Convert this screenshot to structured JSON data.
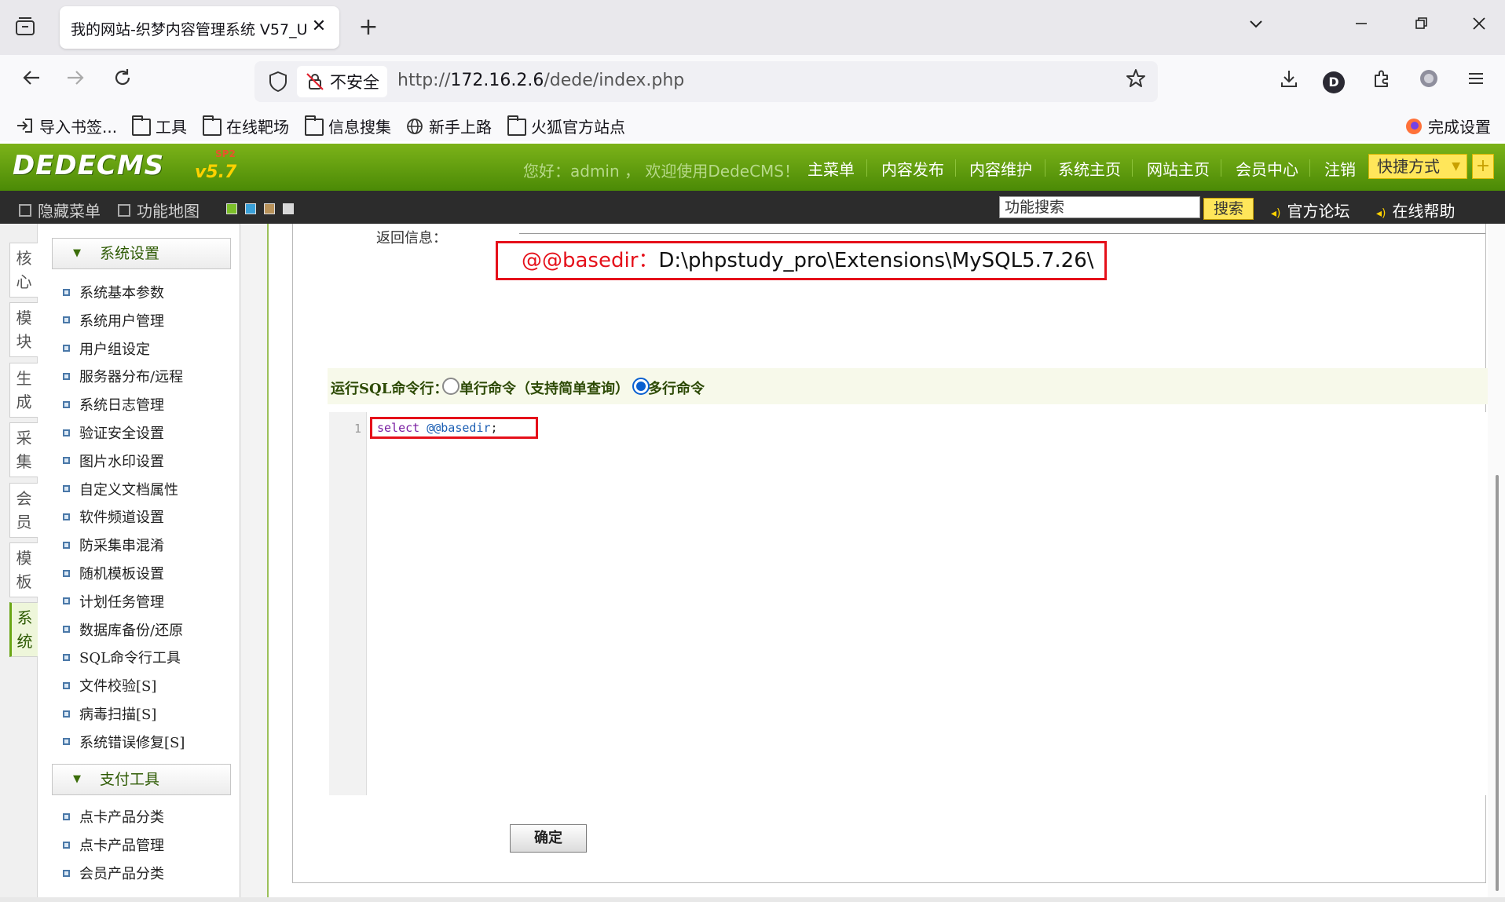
{
  "browser": {
    "tab_title": "我的网站-织梦内容管理系统 V57_U",
    "tab_close": "✕",
    "new_tab": "+",
    "window_controls": {
      "chevron": "⌵",
      "minimize": "—",
      "restore": "❐",
      "close": "✕"
    },
    "url_insecure_label": "不安全",
    "url_prefix": "http://",
    "url_host": "172.16.2.6",
    "url_path": "/dede/index.php",
    "profile_letter": "D",
    "bookmarks": [
      "导入书签...",
      "工具",
      "在线靶场",
      "信息搜集",
      "新手上路",
      "火狐官方站点"
    ],
    "finish_setup": "完成设置",
    "icons": {
      "back": "back-arrow-icon",
      "forward": "forward-arrow-icon",
      "reload": "reload-icon",
      "shield": "shield-icon",
      "lock": "insecure-lock-icon",
      "star": "bookmark-star-icon",
      "download": "download-icon",
      "extensions": "extensions-icon",
      "menu": "hamburger-menu-icon"
    }
  },
  "dede": {
    "logo": "DEDECMS",
    "version": "v5.7",
    "sp": "SP2",
    "welcome": "您好：admin ， 欢迎使用DedeCMS！",
    "nav": [
      "主菜单",
      "内容发布",
      "内容维护",
      "系统主页",
      "网站主页",
      "会员中心",
      "注销"
    ],
    "shortcut": "快捷方式",
    "shortcut_arrow": "▼",
    "shortcut_plus": "+",
    "subbar": {
      "hide_menu": "隐藏菜单",
      "feature_map": "功能地图",
      "search_value": "功能搜索",
      "search_button": "搜索",
      "forum": "官方论坛",
      "help": "在线帮助"
    },
    "skin_colors": [
      "#7cbf2a",
      "#3aa0d8",
      "#b8925a",
      "#d8d8d8"
    ]
  },
  "vtabs": [
    {
      "label": "核心",
      "l1": "核",
      "l2": "心"
    },
    {
      "label": "模块",
      "l1": "模",
      "l2": "块"
    },
    {
      "label": "生成",
      "l1": "生",
      "l2": "成"
    },
    {
      "label": "采集",
      "l1": "采",
      "l2": "集"
    },
    {
      "label": "会员",
      "l1": "会",
      "l2": "员"
    },
    {
      "label": "模板",
      "l1": "模",
      "l2": "板"
    },
    {
      "label": "系统",
      "l1": "系",
      "l2": "统",
      "active": true
    }
  ],
  "menu": {
    "group1": "系统设置",
    "group1_items": [
      "系统基本参数",
      "系统用户管理",
      "用户组设定",
      "服务器分布/远程",
      "系统日志管理",
      "验证安全设置",
      "图片水印设置",
      "自定义文档属性",
      "软件频道设置",
      "防采集串混淆",
      "随机模板设置",
      "计划任务管理",
      "数据库备份/还原",
      "SQL命令行工具",
      "文件校验[S]",
      "病毒扫描[S]",
      "系统错误修复[S]"
    ],
    "group2": "支付工具",
    "group2_items": [
      "点卡产品分类",
      "点卡产品管理",
      "会员产品分类"
    ]
  },
  "main": {
    "return_label": "返回信息：",
    "result_key": "@@basedir：",
    "result_value": "D:\\phpstudy_pro\\Extensions\\MySQL5.7.26\\",
    "sql_mode_label": "运行SQL命令行：",
    "radio_single": "单行命令（支持简单查询）",
    "radio_multi": "多行命令",
    "selected_mode": "多行命令",
    "line_number": "1",
    "code_keyword": "select",
    "code_variable": "@@basedir",
    "code_end": ";",
    "confirm_button": "确定"
  }
}
